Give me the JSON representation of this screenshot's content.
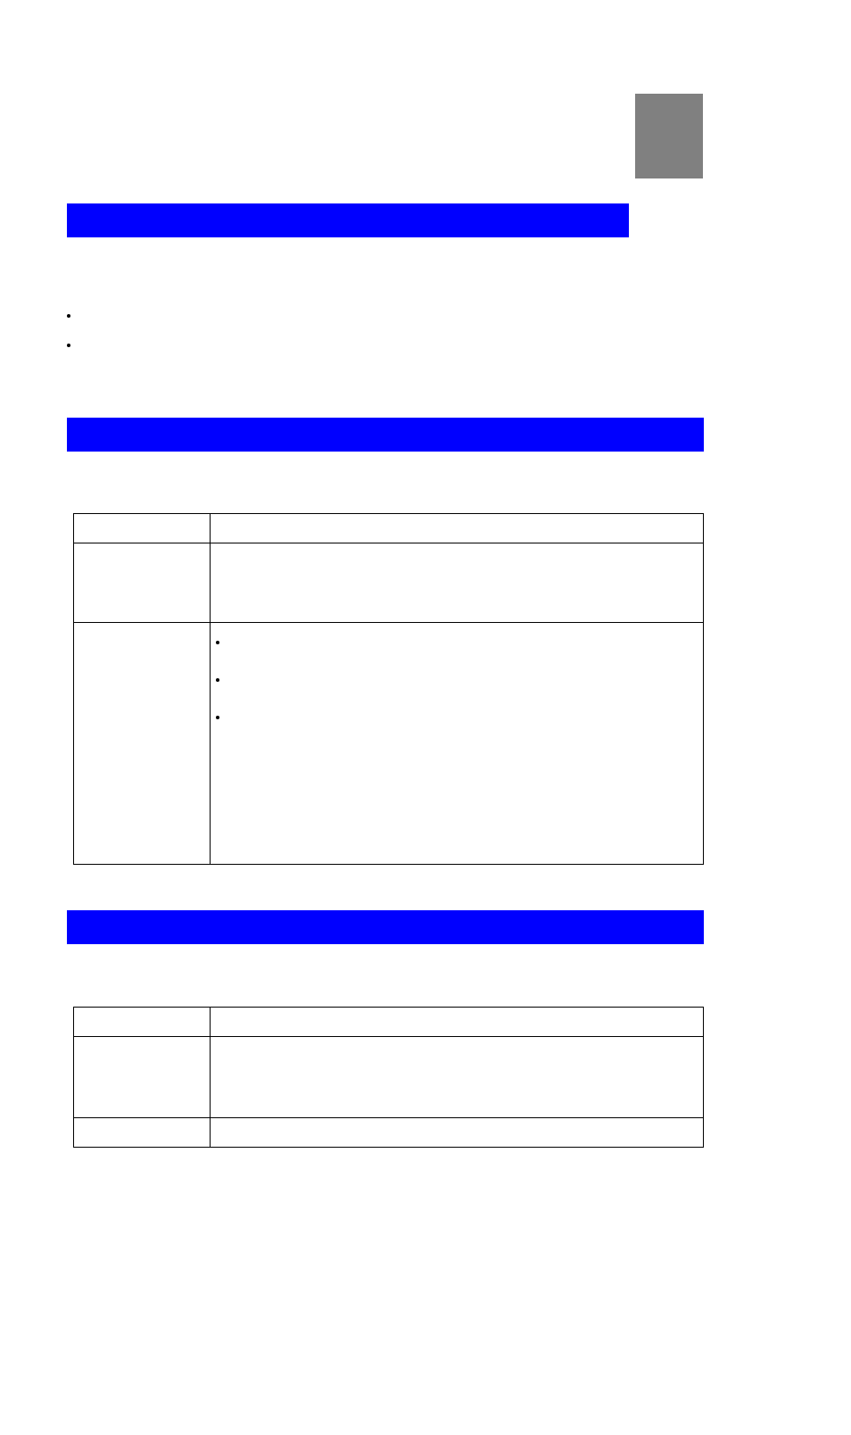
{
  "top_box": "",
  "bar1_text": "",
  "bar2_text": "",
  "bar3_text": "",
  "top_list": [
    "",
    ""
  ],
  "table1": {
    "rows": [
      {
        "left": "",
        "right": ""
      },
      {
        "left": "",
        "right": ""
      },
      {
        "left": "",
        "right_list": [
          "",
          "",
          ""
        ]
      }
    ]
  },
  "table2": {
    "rows": [
      {
        "left": "",
        "right": ""
      },
      {
        "left": "",
        "right": ""
      },
      {
        "left": "",
        "right": ""
      }
    ]
  }
}
